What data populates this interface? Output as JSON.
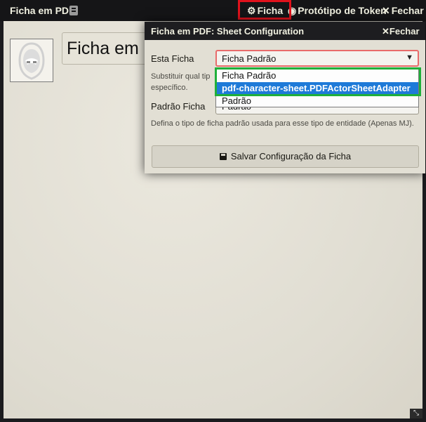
{
  "main_window": {
    "title": "Ficha em PDF",
    "header_buttons": {
      "sheet": "Ficha",
      "token": "Protótipo de Token",
      "close": "Fechar"
    },
    "name_field_value": "Ficha em"
  },
  "dialog": {
    "title": "Ficha em PDF: Sheet Configuration",
    "close_label": "Fechar",
    "this_sheet_label": "Esta Ficha",
    "this_sheet_selected": "Ficha Padrão",
    "this_sheet_hint_1": "Substituir qual tip",
    "this_sheet_hint_2": "específico.",
    "default_sheet_label": "Padrão Ficha",
    "default_sheet_value": "Padrão",
    "default_sheet_hint": "Defina o tipo de ficha padrão usada para esse tipo de entidade (Apenas MJ).",
    "save_button": "Salvar Configuração da Ficha"
  },
  "dropdown_options": [
    "Ficha Padrão",
    "pdf-character-sheet.PDFActorSheetAdapter",
    "Padrão"
  ],
  "colors": {
    "highlight_red": "#e0121c",
    "highlight_green": "#1fb03a",
    "selected_option": "#1e7ad8"
  }
}
